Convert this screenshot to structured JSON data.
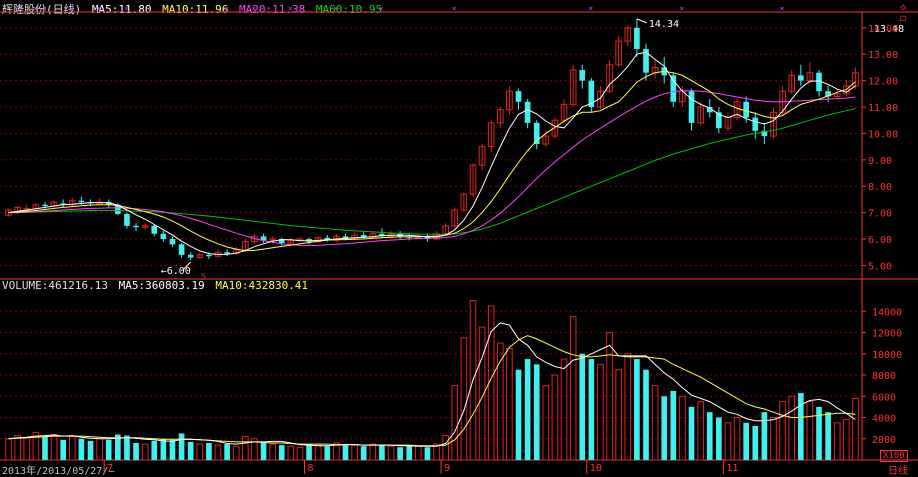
{
  "header": {
    "title": "辉隆股份(日线)",
    "ma5_label": "MA5:",
    "ma5_value": "11.80",
    "ma10_label": "MA10:",
    "ma10_value": "11.96",
    "ma20_label": "MA20:",
    "ma20_value": "11.38",
    "ma60_label": "MA60:",
    "ma60_value": "10.95"
  },
  "volume_header": {
    "vol_label": "VOLUME:",
    "vol_value": "461216.13",
    "ma5_label": "MA5:",
    "ma5_value": "360803.19",
    "ma10_label": "MA10:",
    "ma10_value": "432830.41"
  },
  "annotations": {
    "high": "14.34",
    "low": "6.00",
    "low_marker": "5",
    "current_price": "13.48",
    "date_label": "2013年/2013/05/27/—",
    "unit_label": "X100",
    "period_label": "日线"
  },
  "month_labels": [
    "7",
    "8",
    "9",
    "10",
    "11"
  ],
  "colors": {
    "up": "#e02020",
    "down": "#40f0f0",
    "ma5": "#ffffff",
    "ma10": "#ffff40",
    "ma20": "#ff40ff",
    "ma60": "#00c000",
    "grid": "#800000",
    "axis": "#ff3030"
  },
  "chart_data": [
    {
      "type": "candlestick",
      "title": "辉隆股份(日线)",
      "ylim": [
        4.6,
        14.6
      ],
      "yticks": [
        "14.00",
        "13.00",
        "12.00",
        "11.00",
        "10.00",
        "9.00",
        "8.00",
        "7.00",
        "6.00",
        "5.00"
      ],
      "candles": [
        [
          6.9,
          7.1,
          6.85,
          7.15
        ],
        [
          7.0,
          7.2,
          6.95,
          7.25
        ],
        [
          7.1,
          7.15,
          7.0,
          7.3
        ],
        [
          7.15,
          7.3,
          7.1,
          7.35
        ],
        [
          7.3,
          7.25,
          7.15,
          7.4
        ],
        [
          7.25,
          7.4,
          7.2,
          7.45
        ],
        [
          7.35,
          7.3,
          7.2,
          7.5
        ],
        [
          7.3,
          7.45,
          7.25,
          7.55
        ],
        [
          7.45,
          7.4,
          7.3,
          7.6
        ],
        [
          7.4,
          7.35,
          7.25,
          7.5
        ],
        [
          7.35,
          7.4,
          7.3,
          7.55
        ],
        [
          7.4,
          7.3,
          7.2,
          7.5
        ],
        [
          7.3,
          6.95,
          6.9,
          7.35
        ],
        [
          6.95,
          6.5,
          6.4,
          7.0
        ],
        [
          6.5,
          6.45,
          6.3,
          6.6
        ],
        [
          6.45,
          6.5,
          6.35,
          6.6
        ],
        [
          6.5,
          6.2,
          6.1,
          6.55
        ],
        [
          6.2,
          6.0,
          5.9,
          6.3
        ],
        [
          6.0,
          5.8,
          5.7,
          6.1
        ],
        [
          5.8,
          5.4,
          5.3,
          5.85
        ],
        [
          5.4,
          5.3,
          5.2,
          5.5
        ],
        [
          5.3,
          5.4,
          5.25,
          5.5
        ],
        [
          5.4,
          5.35,
          5.25,
          5.5
        ],
        [
          5.35,
          5.5,
          5.3,
          5.6
        ],
        [
          5.5,
          5.45,
          5.35,
          5.6
        ],
        [
          5.45,
          5.6,
          5.4,
          5.7
        ],
        [
          5.6,
          5.9,
          5.55,
          6.0
        ],
        [
          5.9,
          6.1,
          5.85,
          6.2
        ],
        [
          6.1,
          5.95,
          5.85,
          6.2
        ],
        [
          5.95,
          6.0,
          5.9,
          6.1
        ],
        [
          6.0,
          5.85,
          5.75,
          6.05
        ],
        [
          5.85,
          5.95,
          5.8,
          6.05
        ],
        [
          5.95,
          6.0,
          5.9,
          6.1
        ],
        [
          6.0,
          5.9,
          5.8,
          6.05
        ],
        [
          5.9,
          6.05,
          5.85,
          6.1
        ],
        [
          6.05,
          5.95,
          5.9,
          6.15
        ],
        [
          5.95,
          6.1,
          5.9,
          6.2
        ],
        [
          6.1,
          6.0,
          5.95,
          6.2
        ],
        [
          6.0,
          6.15,
          5.95,
          6.25
        ],
        [
          6.15,
          6.05,
          6.0,
          6.3
        ],
        [
          6.05,
          6.2,
          6.0,
          6.3
        ],
        [
          6.2,
          6.1,
          6.05,
          6.4
        ],
        [
          6.1,
          6.2,
          6.05,
          6.3
        ],
        [
          6.2,
          6.1,
          6.0,
          6.3
        ],
        [
          6.1,
          6.05,
          5.95,
          6.2
        ],
        [
          6.05,
          6.1,
          6.0,
          6.2
        ],
        [
          6.1,
          6.0,
          5.9,
          6.2
        ],
        [
          6.0,
          6.2,
          5.95,
          6.3
        ],
        [
          6.2,
          6.5,
          6.15,
          6.6
        ],
        [
          6.5,
          7.1,
          6.4,
          7.2
        ],
        [
          7.1,
          7.7,
          7.0,
          7.75
        ],
        [
          7.7,
          8.8,
          7.6,
          8.85
        ],
        [
          8.8,
          9.5,
          8.6,
          9.6
        ],
        [
          9.5,
          10.4,
          9.3,
          10.5
        ],
        [
          10.4,
          10.9,
          10.2,
          11.0
        ],
        [
          10.9,
          11.6,
          10.7,
          11.8
        ],
        [
          11.6,
          11.2,
          10.9,
          11.7
        ],
        [
          11.2,
          10.4,
          10.2,
          11.3
        ],
        [
          10.4,
          9.6,
          9.4,
          10.5
        ],
        [
          9.6,
          9.9,
          9.5,
          10.1
        ],
        [
          9.9,
          10.5,
          9.8,
          10.6
        ],
        [
          10.5,
          11.1,
          10.4,
          11.3
        ],
        [
          11.1,
          12.4,
          11.0,
          12.6
        ],
        [
          12.4,
          12.0,
          11.7,
          12.6
        ],
        [
          12.0,
          11.0,
          10.8,
          12.1
        ],
        [
          11.0,
          11.6,
          10.9,
          11.8
        ],
        [
          11.6,
          12.6,
          11.5,
          12.8
        ],
        [
          12.6,
          13.5,
          12.5,
          13.7
        ],
        [
          13.5,
          14.0,
          13.3,
          14.1
        ],
        [
          14.0,
          13.2,
          12.9,
          14.34
        ],
        [
          13.2,
          12.3,
          12.0,
          13.4
        ],
        [
          12.3,
          12.5,
          12.1,
          12.8
        ],
        [
          12.5,
          12.2,
          11.9,
          12.9
        ],
        [
          12.2,
          11.2,
          11.0,
          12.3
        ],
        [
          11.2,
          11.6,
          11.0,
          11.8
        ],
        [
          11.6,
          10.4,
          10.1,
          11.7
        ],
        [
          10.4,
          11.0,
          10.3,
          11.2
        ],
        [
          11.0,
          10.8,
          10.6,
          11.3
        ],
        [
          10.8,
          10.2,
          10.0,
          11.0
        ],
        [
          10.2,
          10.6,
          10.1,
          10.8
        ],
        [
          10.6,
          11.2,
          10.5,
          11.3
        ],
        [
          11.2,
          10.6,
          10.4,
          11.4
        ],
        [
          10.6,
          10.1,
          9.8,
          10.8
        ],
        [
          10.1,
          9.9,
          9.6,
          10.4
        ],
        [
          9.9,
          10.8,
          9.8,
          11.0
        ],
        [
          10.8,
          11.6,
          10.7,
          11.8
        ],
        [
          11.6,
          12.2,
          11.5,
          12.4
        ],
        [
          12.2,
          12.0,
          11.8,
          12.6
        ],
        [
          12.0,
          12.3,
          11.9,
          12.7
        ],
        [
          12.3,
          11.6,
          11.4,
          12.4
        ],
        [
          11.6,
          11.4,
          11.2,
          11.8
        ],
        [
          11.4,
          11.5,
          11.3,
          11.7
        ],
        [
          11.5,
          11.8,
          11.4,
          12.0
        ],
        [
          11.8,
          12.3,
          11.7,
          12.5
        ]
      ],
      "ma5": [
        7.0,
        7.05,
        7.1,
        7.15,
        7.2,
        7.25,
        7.3,
        7.32,
        7.35,
        7.38,
        7.38,
        7.38,
        7.28,
        7.1,
        6.92,
        6.75,
        6.55,
        6.35,
        6.15,
        5.92,
        5.72,
        5.55,
        5.45,
        5.42,
        5.42,
        5.47,
        5.56,
        5.71,
        5.82,
        5.92,
        5.98,
        5.97,
        5.94,
        5.93,
        5.95,
        5.97,
        6.0,
        6.03,
        6.05,
        6.07,
        6.09,
        6.13,
        6.14,
        6.14,
        6.14,
        6.11,
        6.09,
        6.08,
        6.15,
        6.35,
        6.72,
        7.25,
        7.95,
        8.75,
        9.5,
        10.2,
        10.72,
        10.9,
        10.74,
        10.47,
        10.27,
        10.21,
        10.59,
        11.0,
        11.14,
        11.34,
        11.86,
        12.16,
        12.54,
        13.0,
        13.08,
        12.8,
        12.55,
        12.0,
        11.6,
        11.3,
        11.1,
        10.96,
        10.72,
        10.6,
        10.72,
        10.56,
        10.44,
        10.36,
        10.48,
        10.84,
        11.3,
        11.72,
        11.98,
        11.99,
        11.86,
        11.68,
        11.56,
        11.8
      ],
      "ma10": [
        7.0,
        7.02,
        7.05,
        7.08,
        7.12,
        7.16,
        7.2,
        7.23,
        7.26,
        7.29,
        7.3,
        7.3,
        7.27,
        7.2,
        7.12,
        7.04,
        6.95,
        6.83,
        6.68,
        6.5,
        6.3,
        6.12,
        5.96,
        5.82,
        5.7,
        5.62,
        5.56,
        5.57,
        5.62,
        5.67,
        5.72,
        5.77,
        5.82,
        5.87,
        5.92,
        5.96,
        5.98,
        5.98,
        5.99,
        6.0,
        6.03,
        6.05,
        6.07,
        6.08,
        6.09,
        6.09,
        6.1,
        6.11,
        6.14,
        6.22,
        6.4,
        6.65,
        7.0,
        7.42,
        7.9,
        8.42,
        8.9,
        9.35,
        9.72,
        10.0,
        10.23,
        10.46,
        10.66,
        10.8,
        10.8,
        10.86,
        11.04,
        11.2,
        11.56,
        11.95,
        12.15,
        12.3,
        12.35,
        12.3,
        12.2,
        12.0,
        11.8,
        11.6,
        11.3,
        11.1,
        10.95,
        10.85,
        10.76,
        10.64,
        10.58,
        10.68,
        10.9,
        11.1,
        11.2,
        11.3,
        11.42,
        11.56,
        11.66,
        11.96
      ],
      "ma20": [
        7.0,
        7.01,
        7.02,
        7.04,
        7.06,
        7.08,
        7.1,
        7.12,
        7.14,
        7.16,
        7.17,
        7.18,
        7.18,
        7.17,
        7.15,
        7.12,
        7.08,
        7.03,
        6.96,
        6.88,
        6.78,
        6.68,
        6.56,
        6.45,
        6.34,
        6.22,
        6.12,
        6.02,
        5.94,
        5.88,
        5.82,
        5.78,
        5.76,
        5.76,
        5.76,
        5.78,
        5.8,
        5.82,
        5.85,
        5.88,
        5.91,
        5.94,
        5.96,
        5.98,
        6.0,
        6.02,
        6.03,
        6.04,
        6.06,
        6.1,
        6.2,
        6.33,
        6.5,
        6.72,
        6.98,
        7.28,
        7.6,
        7.95,
        8.3,
        8.62,
        8.92,
        9.2,
        9.48,
        9.75,
        9.98,
        10.2,
        10.42,
        10.63,
        10.84,
        11.04,
        11.22,
        11.38,
        11.5,
        11.58,
        11.62,
        11.62,
        11.6,
        11.56,
        11.5,
        11.44,
        11.38,
        11.32,
        11.26,
        11.22,
        11.2,
        11.2,
        11.22,
        11.24,
        11.26,
        11.28,
        11.3,
        11.32,
        11.34,
        11.38
      ],
      "ma60": [
        7.0,
        7.0,
        7.01,
        7.02,
        7.03,
        7.04,
        7.05,
        7.06,
        7.07,
        7.08,
        7.08,
        7.08,
        7.08,
        7.07,
        7.06,
        7.05,
        7.03,
        7.01,
        6.99,
        6.96,
        6.93,
        6.9,
        6.87,
        6.83,
        6.79,
        6.75,
        6.71,
        6.67,
        6.63,
        6.59,
        6.55,
        6.51,
        6.48,
        6.45,
        6.42,
        6.39,
        6.36,
        6.33,
        6.31,
        6.29,
        6.27,
        6.25,
        6.23,
        6.21,
        6.2,
        6.19,
        6.18,
        6.18,
        6.18,
        6.2,
        6.24,
        6.3,
        6.38,
        6.48,
        6.6,
        6.74,
        6.88,
        7.02,
        7.16,
        7.3,
        7.44,
        7.58,
        7.72,
        7.86,
        8.0,
        8.14,
        8.28,
        8.42,
        8.56,
        8.7,
        8.84,
        8.98,
        9.1,
        9.22,
        9.32,
        9.42,
        9.52,
        9.62,
        9.7,
        9.78,
        9.86,
        9.94,
        10.0,
        10.06,
        10.12,
        10.2,
        10.3,
        10.4,
        10.5,
        10.6,
        10.7,
        10.78,
        10.86,
        10.95
      ]
    },
    {
      "type": "bar",
      "title": "VOLUME",
      "ylim": [
        0,
        16000
      ],
      "yticks": [
        "14000",
        "12000",
        "10000",
        "8000",
        "6000",
        "4000",
        "2000"
      ],
      "values": [
        2000,
        2300,
        2100,
        2600,
        2200,
        2400,
        1900,
        2200,
        2000,
        1800,
        2100,
        1900,
        2400,
        2300,
        1600,
        1500,
        1800,
        2000,
        1900,
        2500,
        1700,
        1500,
        1600,
        1400,
        1500,
        1300,
        2200,
        2000,
        1600,
        1500,
        1400,
        1300,
        1200,
        1500,
        1400,
        1300,
        1600,
        1500,
        1400,
        1300,
        1500,
        1400,
        1300,
        1200,
        1400,
        1300,
        1200,
        1500,
        2300,
        7000,
        11500,
        15000,
        12500,
        14500,
        11000,
        10500,
        8500,
        9500,
        9000,
        7000,
        8000,
        9500,
        13500,
        10000,
        9500,
        9000,
        12000,
        8500,
        10000,
        9500,
        8500,
        7000,
        6000,
        6500,
        6000,
        5000,
        5500,
        4500,
        4000,
        3500,
        4000,
        3500,
        3200,
        4500,
        4000,
        5500,
        6000,
        6300,
        5500,
        5000,
        4500,
        3500,
        3800,
        5800
      ],
      "ma5": [
        2000,
        2100,
        2150,
        2250,
        2300,
        2350,
        2250,
        2300,
        2150,
        2050,
        2000,
        2000,
        2050,
        2100,
        2050,
        1950,
        1900,
        1800,
        1750,
        1950,
        1950,
        1900,
        1850,
        1750,
        1550,
        1500,
        1600,
        1700,
        1700,
        1750,
        1750,
        1600,
        1450,
        1400,
        1350,
        1350,
        1400,
        1450,
        1450,
        1400,
        1400,
        1400,
        1400,
        1350,
        1350,
        1300,
        1300,
        1300,
        1550,
        2650,
        4650,
        7550,
        9650,
        12100,
        12900,
        12700,
        11400,
        10800,
        9700,
        9200,
        8800,
        8600,
        9400,
        9600,
        10000,
        10400,
        10800,
        9800,
        9800,
        9800,
        9800,
        9000,
        8200,
        7600,
        6800,
        6100,
        5800,
        5500,
        5000,
        4500,
        4300,
        3900,
        3700,
        3700,
        3800,
        4100,
        4600,
        5200,
        5600,
        5700,
        5500,
        4900,
        4400,
        3800
      ],
      "ma10": [
        2000,
        2050,
        2100,
        2150,
        2200,
        2250,
        2250,
        2250,
        2250,
        2200,
        2150,
        2100,
        2100,
        2100,
        2100,
        2050,
        2000,
        1950,
        1950,
        1950,
        1950,
        1900,
        1850,
        1800,
        1750,
        1700,
        1700,
        1700,
        1650,
        1600,
        1600,
        1550,
        1500,
        1500,
        1500,
        1500,
        1450,
        1450,
        1450,
        1400,
        1400,
        1400,
        1400,
        1400,
        1400,
        1350,
        1350,
        1350,
        1400,
        1900,
        2900,
        4300,
        5900,
        7700,
        9300,
        10600,
        11300,
        11700,
        11400,
        11000,
        10600,
        10200,
        9900,
        9700,
        9700,
        9800,
        9900,
        9800,
        9700,
        9700,
        9700,
        9600,
        9500,
        9000,
        8600,
        8200,
        7800,
        7300,
        6800,
        6300,
        5800,
        5300,
        5000,
        4800,
        4500,
        4200,
        4000,
        4000,
        4100,
        4200,
        4300,
        4400,
        4400,
        4300
      ]
    }
  ]
}
